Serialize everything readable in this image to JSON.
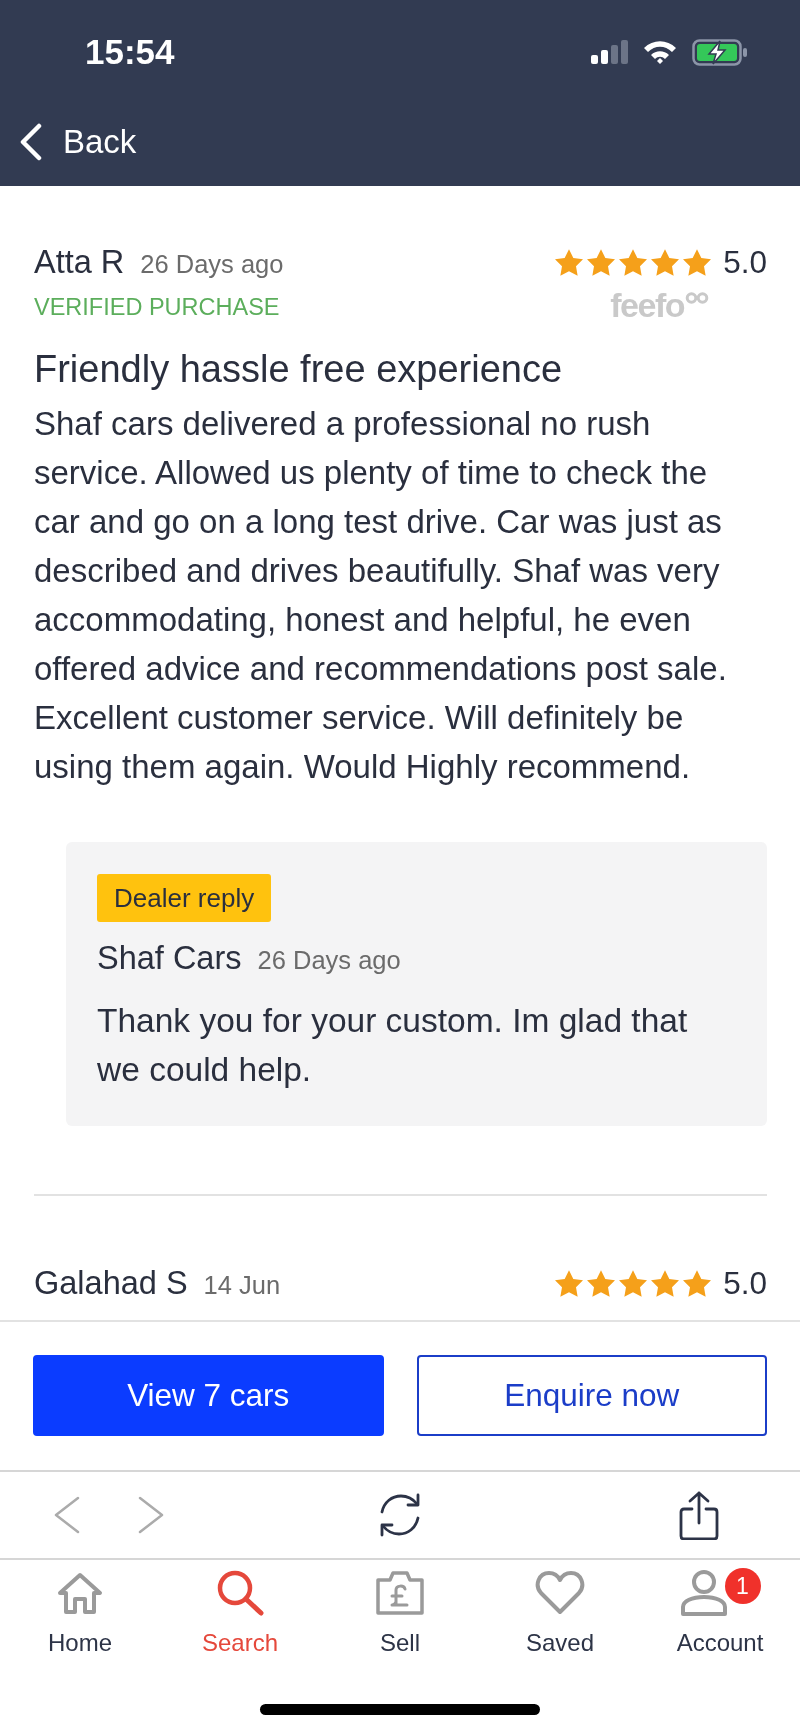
{
  "status_bar": {
    "time": "15:54"
  },
  "nav_bar": {
    "back_label": "Back"
  },
  "reviews": [
    {
      "author": "Atta R",
      "date": "26 Days ago",
      "stars": 5,
      "rating": "5.0",
      "source_logo": "feefo",
      "verified_label": "VERIFIED PURCHASE",
      "title": "Friendly hassle free experience",
      "body": "Shaf cars delivered a professional no rush service. Allowed us plenty of time to check the car and go on a long test drive. Car was just as described and drives beautifully. Shaf was very accommodating, honest and helpful, he even offered advice and recommendations post sale. Excellent customer service. Will definitely be using them again. Would Highly recommend.",
      "dealer_reply": {
        "badge": "Dealer reply",
        "author": "Shaf Cars",
        "date": "26 Days ago",
        "text": "Thank you for your custom. Im glad that we could help."
      }
    },
    {
      "author": "Galahad S",
      "date": "14 Jun",
      "stars": 5,
      "rating": "5.0"
    }
  ],
  "actions": [
    {
      "label": "View 7 cars",
      "kind": "primary"
    },
    {
      "label": "Enquire now",
      "kind": "outline"
    }
  ],
  "browser_toolbar": {
    "back": {
      "disabled": true
    },
    "forward": {
      "disabled": true
    }
  },
  "tab_bar": [
    {
      "kind": "home",
      "label": "Home",
      "selected": false
    },
    {
      "kind": "search",
      "label": "Search",
      "selected": true
    },
    {
      "kind": "sell",
      "label": "Sell",
      "selected": false
    },
    {
      "kind": "saved",
      "label": "Saved",
      "selected": false
    },
    {
      "kind": "account",
      "label": "Account",
      "selected": false,
      "badge": "1"
    }
  ]
}
